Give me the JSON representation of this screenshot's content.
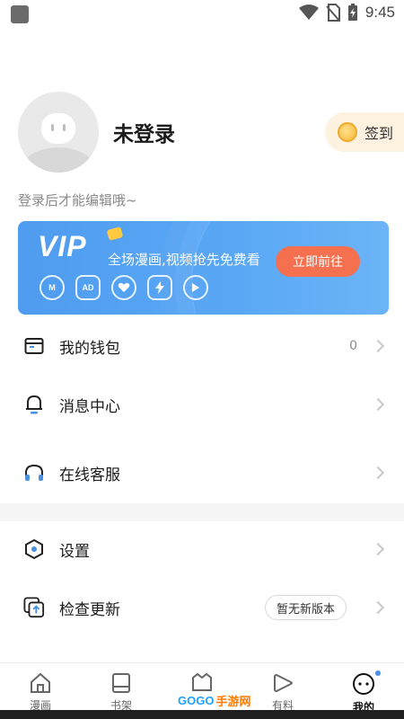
{
  "status_bar": {
    "time": "9:45"
  },
  "profile": {
    "username": "未登录",
    "checkin_label": "签到",
    "hint": "登录后才能编辑哦~"
  },
  "vip_banner": {
    "logo": "VIP",
    "text": "全场漫画,视频抢先免费看",
    "button": "立即前往",
    "icons": [
      "M",
      "AD",
      "heart",
      "lightning",
      "play"
    ]
  },
  "menu": {
    "wallet": {
      "label": "我的钱包",
      "value": "0"
    },
    "messages": {
      "label": "消息中心"
    },
    "support": {
      "label": "在线客服"
    },
    "settings": {
      "label": "设置"
    },
    "update": {
      "label": "检查更新",
      "badge": "暂无新版本"
    }
  },
  "tabbar": {
    "tabs": [
      {
        "label": "漫画",
        "icon": "house-icon"
      },
      {
        "label": "书架",
        "icon": "book-icon"
      },
      {
        "label": "",
        "icon": "vip-bag-icon"
      },
      {
        "label": "有料",
        "icon": "play-icon"
      },
      {
        "label": "我的",
        "icon": "face-icon"
      }
    ],
    "active": "我的"
  },
  "watermark": {
    "brand": "GOGO",
    "suffix": "手游网"
  },
  "colors": {
    "vip_gradient_start": "#4f9cf0",
    "vip_button": "#f4704f",
    "checkin_bg": "#fdf1df",
    "accent": "#4a90e2"
  }
}
